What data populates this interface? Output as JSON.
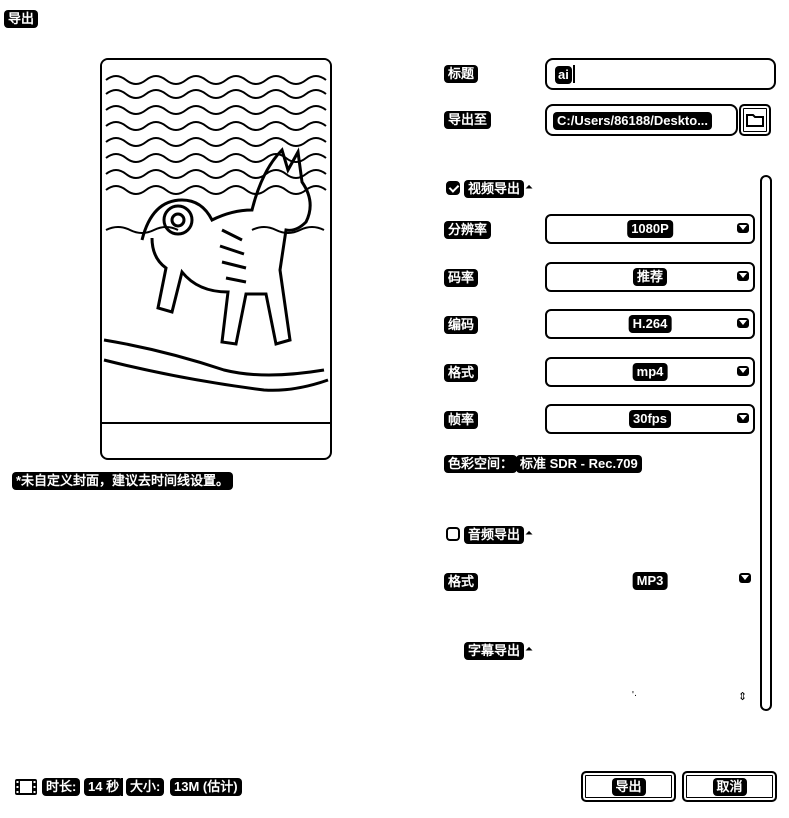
{
  "window": {
    "title": "导出"
  },
  "preview": {
    "cover_hint": "*未自定义封面，建议去时间线设置。"
  },
  "form": {
    "title_label": "标题",
    "title_value": "ai",
    "export_to_label": "导出至",
    "export_path": "C:/Users/86188/Deskto..."
  },
  "video_export": {
    "label": "视频导出",
    "checked": true,
    "settings": [
      {
        "label": "分辨率",
        "value": "1080P"
      },
      {
        "label": "码率",
        "value": "推荐"
      },
      {
        "label": "编码",
        "value": "H.264"
      },
      {
        "label": "格式",
        "value": "mp4"
      },
      {
        "label": "帧率",
        "value": "30fps"
      }
    ],
    "color_space_label": "色彩空间：",
    "color_space_value": "标准 SDR - Rec.709"
  },
  "audio_export": {
    "label": "音频导出",
    "checked": false,
    "format_label": "格式",
    "format_value": "MP3"
  },
  "subtitle_export": {
    "label": "字幕导出"
  },
  "footer": {
    "duration_label": "时长:",
    "duration_value": "14 秒",
    "size_label": "大小:",
    "size_value": "13M (估计)",
    "export_button": "导出",
    "cancel_button": "取消"
  }
}
